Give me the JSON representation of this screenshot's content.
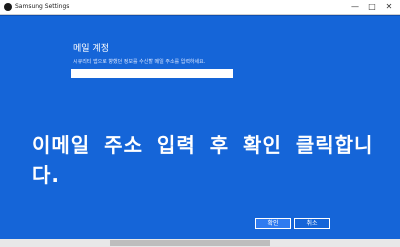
{
  "window": {
    "title": "Samsung Settings",
    "minimize_glyph": "—",
    "maximize_glyph": "□",
    "close_glyph": "✕",
    "app_icon": "samsung-settings-icon"
  },
  "form": {
    "heading": "메일 계정",
    "description": "시큐리티 앱으로 향했던 정보를 수신할 메일 주소를 입력하세요.",
    "email_value": "",
    "email_placeholder": ""
  },
  "overlay": {
    "instruction": "이메일 주소 입력 후 확인 클릭합니다."
  },
  "buttons": {
    "confirm": "확인",
    "cancel": "취소"
  },
  "colors": {
    "background": "#1565d8",
    "primary_button": "#2f7bf0",
    "text": "#ffffff"
  }
}
